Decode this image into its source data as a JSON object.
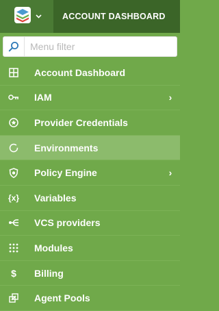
{
  "header": {
    "title": "ACCOUNT DASHBOARD",
    "logo_icon": "stack-logo-icon",
    "dropdown_icon": "chevron-down-icon"
  },
  "filter": {
    "placeholder": "Menu filter",
    "value": "",
    "icon": "search-icon"
  },
  "menu": {
    "items": [
      {
        "label": "Account Dashboard",
        "icon": "grid-icon",
        "has_submenu": false,
        "active": false
      },
      {
        "label": "IAM",
        "icon": "key-icon",
        "has_submenu": true,
        "active": false
      },
      {
        "label": "Provider Credentials",
        "icon": "star-badge-icon",
        "has_submenu": false,
        "active": false
      },
      {
        "label": "Environments",
        "icon": "circle-icon",
        "has_submenu": false,
        "active": true
      },
      {
        "label": "Policy Engine",
        "icon": "shield-icon",
        "has_submenu": true,
        "active": false
      },
      {
        "label": "Variables",
        "icon": "variable-braces-icon",
        "has_submenu": false,
        "active": false
      },
      {
        "label": "VCS providers",
        "icon": "branch-icon",
        "has_submenu": false,
        "active": false
      },
      {
        "label": "Modules",
        "icon": "dots-grid-icon",
        "has_submenu": false,
        "active": false
      },
      {
        "label": "Billing",
        "icon": "dollar-icon",
        "has_submenu": false,
        "active": false
      },
      {
        "label": "Agent Pools",
        "icon": "agent-pool-icon",
        "has_submenu": false,
        "active": false
      }
    ],
    "submenu_glyph": "›",
    "variables_glyph": "{x}",
    "billing_glyph": "$"
  },
  "colors": {
    "background": "#70a94a",
    "topbar": "#3b6528",
    "active_item": "#8cbb6c"
  }
}
